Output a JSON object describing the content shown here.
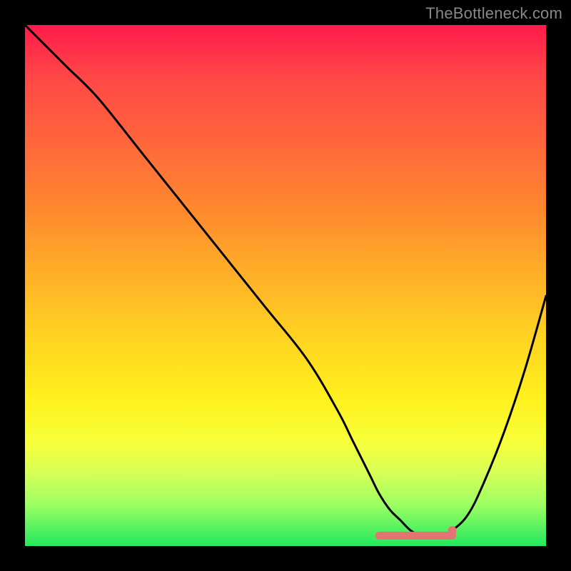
{
  "watermark": "TheBottleneck.com",
  "colors": {
    "background": "#000000",
    "gradient_top": "#ff1a4b",
    "gradient_bottom": "#23e85f",
    "curve": "#000000",
    "marker": "#e57373",
    "watermark_text": "#888888"
  },
  "chart_data": {
    "type": "line",
    "title": "",
    "xlabel": "",
    "ylabel": "",
    "xlim": [
      0,
      100
    ],
    "ylim": [
      0,
      100
    ],
    "grid": false,
    "legend": false,
    "annotations": [],
    "series": [
      {
        "name": "bottleneck-curve",
        "x": [
          0,
          3,
          8,
          14,
          22,
          30,
          38,
          46,
          54,
          60,
          63,
          66,
          68,
          70,
          72,
          74,
          76,
          78,
          80,
          82,
          85,
          88,
          92,
          96,
          100
        ],
        "y": [
          100,
          97,
          92,
          86,
          76,
          66,
          56,
          46,
          36,
          26,
          20,
          14,
          10,
          7,
          5,
          3,
          2,
          2,
          2,
          3,
          6,
          12,
          22,
          34,
          48
        ]
      }
    ],
    "markers": [
      {
        "name": "minimum-band",
        "x_range": [
          68,
          82
        ],
        "y": 2
      },
      {
        "name": "right-dot",
        "x": 82,
        "y": 3
      }
    ],
    "background_gradient": {
      "direction": "vertical",
      "stops": [
        {
          "pos": 0.0,
          "color": "#ff1a4b"
        },
        {
          "pos": 0.1,
          "color": "#ff4747"
        },
        {
          "pos": 0.24,
          "color": "#ff6a3a"
        },
        {
          "pos": 0.36,
          "color": "#ff8a2e"
        },
        {
          "pos": 0.48,
          "color": "#ffb028"
        },
        {
          "pos": 0.6,
          "color": "#ffd321"
        },
        {
          "pos": 0.72,
          "color": "#fff11e"
        },
        {
          "pos": 0.8,
          "color": "#f7ff3a"
        },
        {
          "pos": 0.86,
          "color": "#d6ff56"
        },
        {
          "pos": 0.92,
          "color": "#9dff62"
        },
        {
          "pos": 1.0,
          "color": "#23e85f"
        }
      ]
    }
  }
}
